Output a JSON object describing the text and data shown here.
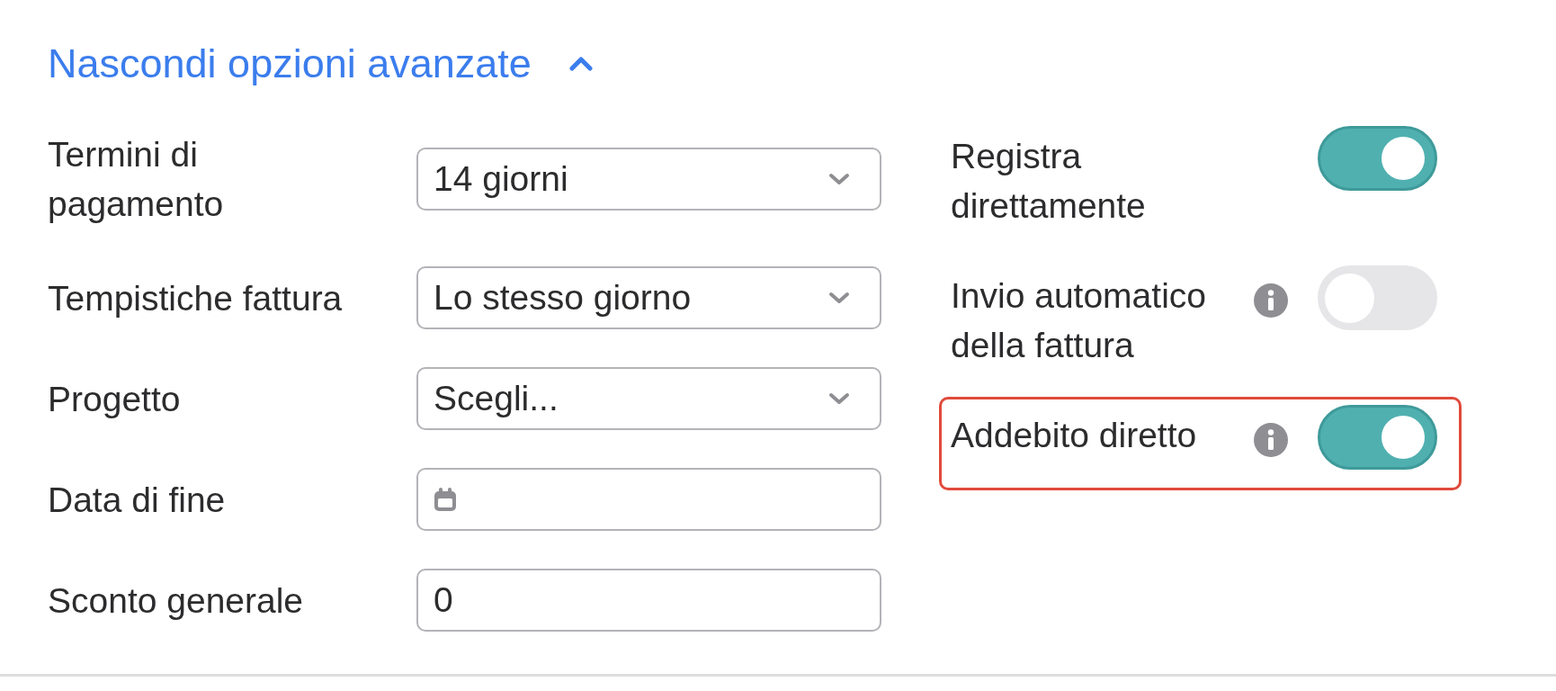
{
  "advanced_toggle": {
    "label": "Nascondi opzioni avanzate",
    "expanded": true
  },
  "fields": [
    {
      "label": "Termini di pagamento",
      "kind": "select",
      "value": "14 giorni"
    },
    {
      "label": "Tempistiche fattura",
      "kind": "select",
      "value": "Lo stesso giorno"
    },
    {
      "label": "Progetto",
      "kind": "select",
      "value": "Scegli..."
    },
    {
      "label": "Data di fine",
      "kind": "date"
    },
    {
      "label": "Sconto generale",
      "kind": "text",
      "value": "0"
    }
  ],
  "options": [
    {
      "label": "Registra direttamente",
      "info": false,
      "on": true,
      "highlighted": false
    },
    {
      "label": "Invio automatico della fattura",
      "info": true,
      "on": false,
      "highlighted": false
    },
    {
      "label": "Addebito diretto",
      "info": true,
      "on": true,
      "highlighted": true
    }
  ]
}
